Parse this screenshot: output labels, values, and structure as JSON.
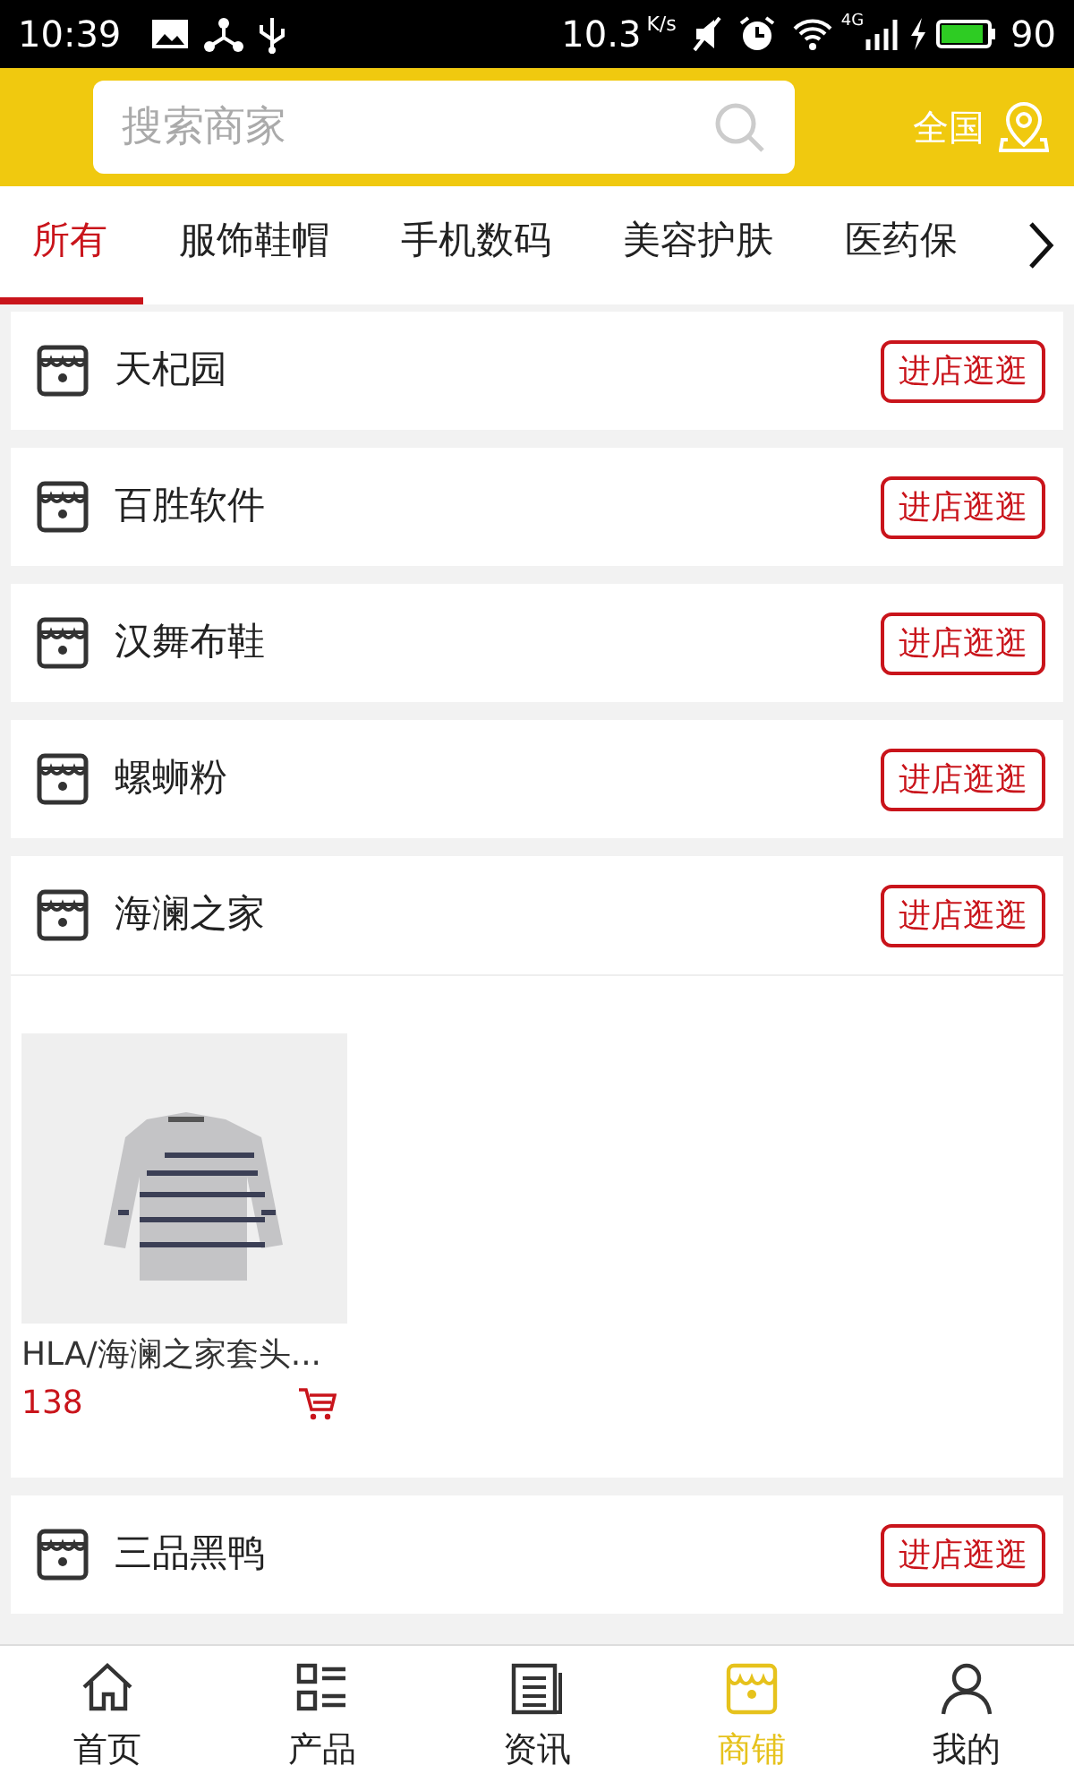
{
  "status_bar": {
    "time": "10:39",
    "speed": "10.3",
    "speed_unit": "K/s",
    "network": "4G",
    "battery": "90"
  },
  "header": {
    "search": {
      "placeholder": "搜索商家"
    },
    "region": "全国"
  },
  "tabs": [
    {
      "label": "所有",
      "selected": true
    },
    {
      "label": "服饰鞋帽",
      "selected": false
    },
    {
      "label": "手机数码",
      "selected": false
    },
    {
      "label": "美容护肤",
      "selected": false
    },
    {
      "label": "医药保",
      "selected": false
    }
  ],
  "shops": [
    {
      "name": "天杞园",
      "button": "进店逛逛"
    },
    {
      "name": "百胜软件",
      "button": "进店逛逛"
    },
    {
      "name": "汉舞布鞋",
      "button": "进店逛逛"
    },
    {
      "name": "螺蛳粉",
      "button": "进店逛逛"
    },
    {
      "name": "海澜之家",
      "button": "进店逛逛",
      "products": [
        {
          "kind": "picture",
          "title": "HLA/海澜之家套头...",
          "price": "138"
        }
      ]
    },
    {
      "name": "三品黑鸭",
      "button": "进店逛逛"
    }
  ],
  "bottom_nav": [
    {
      "label": "首页",
      "kind": "home",
      "selected": false
    },
    {
      "label": "产品",
      "kind": "list",
      "selected": false
    },
    {
      "label": "资讯",
      "kind": "news",
      "selected": false
    },
    {
      "label": "商铺",
      "kind": "shop",
      "selected": true
    },
    {
      "label": "我的",
      "kind": "user",
      "selected": false
    }
  ]
}
